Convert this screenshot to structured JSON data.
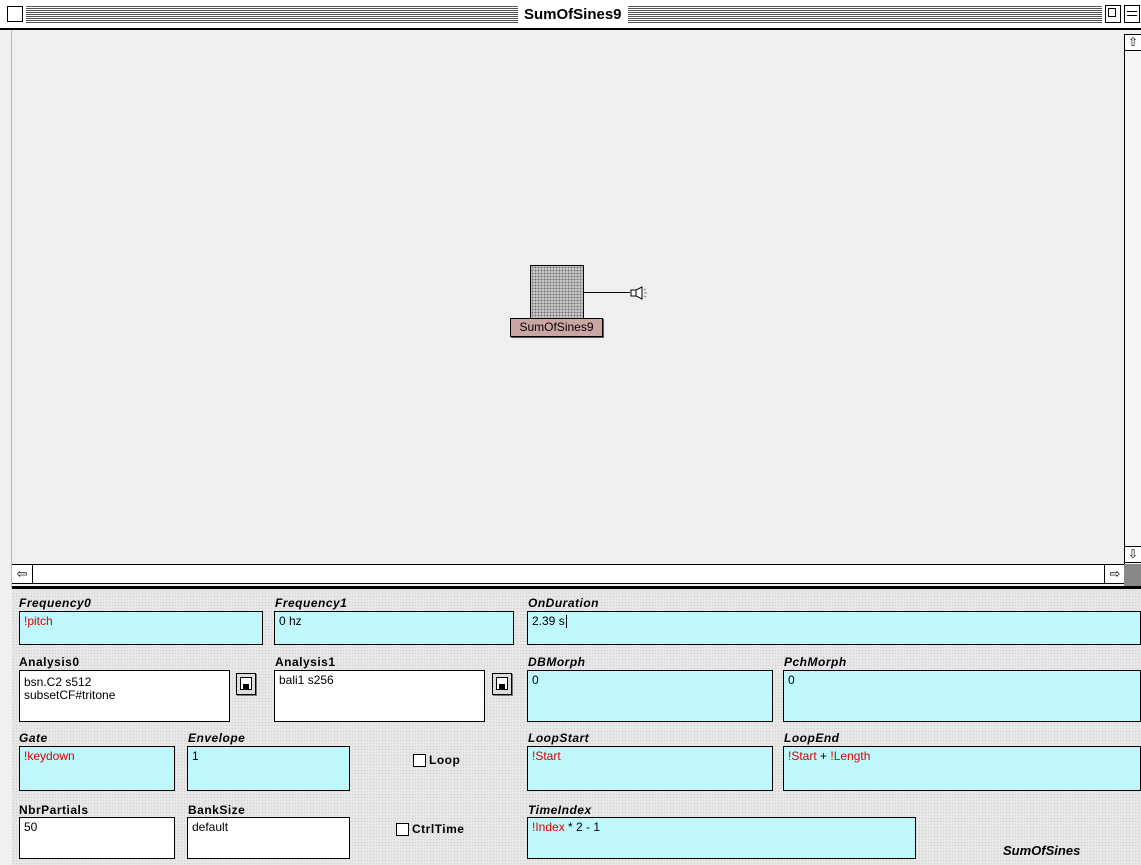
{
  "window": {
    "title": "SumOfSines9"
  },
  "canvas": {
    "sound_object": {
      "label": "SumOfSines9"
    }
  },
  "scrollbars": {
    "up_arrow": "⇧",
    "down_arrow": "⇩",
    "left_arrow": "⇦",
    "right_arrow": "⇨"
  },
  "parameters": {
    "frequency0": {
      "label": "Frequency0",
      "value": "!pitch"
    },
    "frequency1": {
      "label": "Frequency1",
      "value": "0 hz"
    },
    "on_duration": {
      "label": "OnDuration",
      "value": "2.39 s"
    },
    "analysis0": {
      "label": "Analysis0",
      "value": "bsn.C2 s512\nsubsetCF#tritone"
    },
    "analysis1": {
      "label": "Analysis1",
      "value": "bali1 s256"
    },
    "db_morph": {
      "label": "DBMorph",
      "value": "0"
    },
    "pch_morph": {
      "label": "PchMorph",
      "value": "0"
    },
    "gate": {
      "label": "Gate",
      "value": "!keydown"
    },
    "envelope": {
      "label": "Envelope",
      "value": "1"
    },
    "loop": {
      "label": "Loop",
      "checked": false
    },
    "loop_start": {
      "label": "LoopStart",
      "value": "!Start"
    },
    "loop_end": {
      "label": "LoopEnd",
      "value_var1": "!Start",
      "value_op": " + ",
      "value_var2": "!Length"
    },
    "nbr_partials": {
      "label": "NbrPartials",
      "value": "50"
    },
    "bank_size": {
      "label": "BankSize",
      "value": "default"
    },
    "ctrl_time": {
      "label": "CtrlTime",
      "checked": false
    },
    "time_index": {
      "label": "TimeIndex",
      "value_var": "!Index",
      "value_rest": " * 2 - 1"
    }
  },
  "panel": {
    "class_name": "SumOfSines"
  }
}
